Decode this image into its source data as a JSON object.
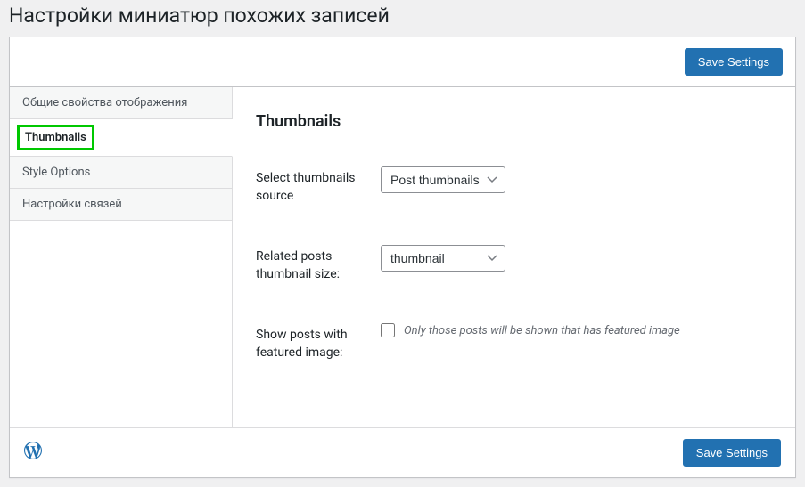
{
  "page_title": "Настройки миниатюр похожих записей",
  "save_button": "Save Settings",
  "sidebar": {
    "tabs": [
      {
        "label": "Общие свойства отображения"
      },
      {
        "label": "Thumbnails"
      },
      {
        "label": "Style Options"
      },
      {
        "label": "Настройки связей"
      }
    ]
  },
  "content": {
    "section_title": "Thumbnails",
    "fields": {
      "source": {
        "label": "Select thumbnails source",
        "selected": "Post thumbnails"
      },
      "size": {
        "label": "Related posts thumbnail size:",
        "selected": "thumbnail"
      },
      "featured": {
        "label": "Show posts with featured image:",
        "description": "Only those posts will be shown that has featured image"
      }
    }
  }
}
